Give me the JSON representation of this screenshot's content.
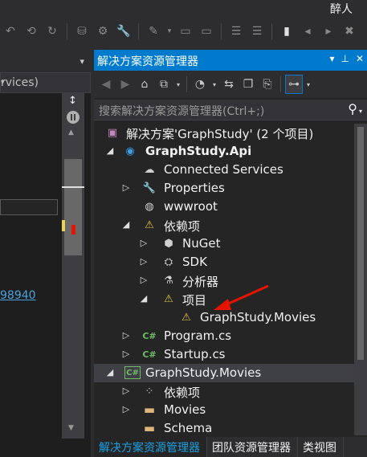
{
  "user": {
    "name": "醉人"
  },
  "toolbar": {
    "icons": [
      "undo-icon",
      "history-icon",
      "refresh-icon",
      "database-icon",
      "tools-icon",
      "wrench-icon",
      "pin-icon",
      "dropdown-icon",
      "layout-icon",
      "layout-icon",
      "align-icon",
      "align-icon",
      "bookmark-icon",
      "bookmark-prev-icon",
      "bookmark-next-icon",
      "bookmark-clear-icon"
    ]
  },
  "left_pane": {
    "dropdown_value": "rvices)",
    "link_text": "98940",
    "scroll_up": "↕"
  },
  "solution_explorer": {
    "title": "解决方案资源管理器",
    "header_buttons": [
      "▾",
      "⊥",
      "✕"
    ],
    "search_placeholder": "搜索解决方案资源管理器(Ctrl+;)",
    "tree": [
      {
        "label": "解决方案'GraphStudy' (2 个项目)"
      },
      {
        "label": "GraphStudy.Api"
      },
      {
        "label": "Connected Services"
      },
      {
        "label": "Properties"
      },
      {
        "label": "wwwroot"
      },
      {
        "label": "依赖项"
      },
      {
        "label": "NuGet"
      },
      {
        "label": "SDK"
      },
      {
        "label": "分析器"
      },
      {
        "label": "项目"
      },
      {
        "label": "GraphStudy.Movies"
      },
      {
        "label": "Program.cs"
      },
      {
        "label": "Startup.cs"
      },
      {
        "label": "GraphStudy.Movies"
      },
      {
        "label": "依赖项"
      },
      {
        "label": "Movies"
      },
      {
        "label": "Schema"
      }
    ],
    "tabs": [
      "解决方案资源管理器",
      "团队资源管理器",
      "类视图"
    ]
  },
  "colors": {
    "accent": "#007acc",
    "annotation": "#e51400",
    "folder": "#dcb67a"
  }
}
